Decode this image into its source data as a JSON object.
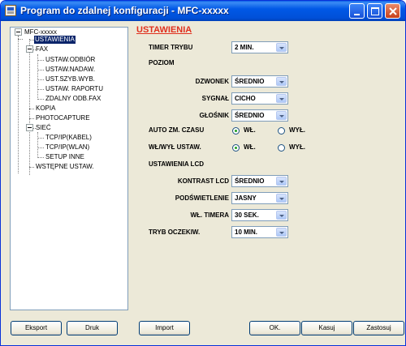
{
  "window": {
    "title": "Program do zdalnej konfiguracji - MFC-xxxxx"
  },
  "tree": {
    "root": "MFC-xxxxx",
    "ustawienia": "USTAWIENIA",
    "fax": "FAX",
    "ustaw_odbior": "USTAW.ODBIÓR",
    "ustaw_nadaw": "USTAW.NADAW.",
    "ust_szyb_wyb": "UST.SZYB.WYB.",
    "ustaw_raportu": "USTAW. RAPORTU",
    "zdalny_odb_fax": "ZDALNY ODB.FAX",
    "kopia": "KOPIA",
    "photocapture": "PHOTOCAPTURE",
    "siec": "SIEĆ",
    "tcp_kabel": "TCP/IP(KABEL)",
    "tcp_wlan": "TCP/IP(WLAN)",
    "setup_inne": "SETUP INNE",
    "wstepne": "WSTĘPNE USTAW."
  },
  "settings": {
    "section_title": "USTAWIENIA",
    "timer_trybu_label": "TIMER TRYBU",
    "timer_trybu_value": "2 MIN.",
    "poziom_label": "POZIOM",
    "dzwonek_label": "DZWONEK",
    "dzwonek_value": "ŚREDNIO",
    "sygnal_label": "SYGNAŁ",
    "sygnal_value": "CICHO",
    "glosnik_label": "GŁOŚNIK",
    "glosnik_value": "ŚREDNIO",
    "auto_zm_label": "AUTO ZM. CZASU",
    "auto_zm_on": "WŁ.",
    "auto_zm_off": "WYŁ.",
    "wl_wyl_label": "WŁ/WYŁ USTAW.",
    "wl_wyl_on": "WŁ.",
    "wl_wyl_off": "WYŁ.",
    "ustawienia_lcd_label": "USTAWIENIA LCD",
    "kontrast_label": "KONTRAST LCD",
    "kontrast_value": "ŚREDNIO",
    "podswietlenie_label": "PODŚWIETLENIE",
    "podswietlenie_value": "JASNY",
    "wl_timera_label": "WŁ. TIMERA",
    "wl_timera_value": "30 SEK.",
    "tryb_oczekiw_label": "TRYB OCZEKIW.",
    "tryb_oczekiw_value": "10 MIN."
  },
  "buttons": {
    "eksport": "Eksport",
    "druk": "Druk",
    "import": "Import",
    "ok": "OK.",
    "kasuj": "Kasuj",
    "zastosuj": "Zastosuj"
  }
}
